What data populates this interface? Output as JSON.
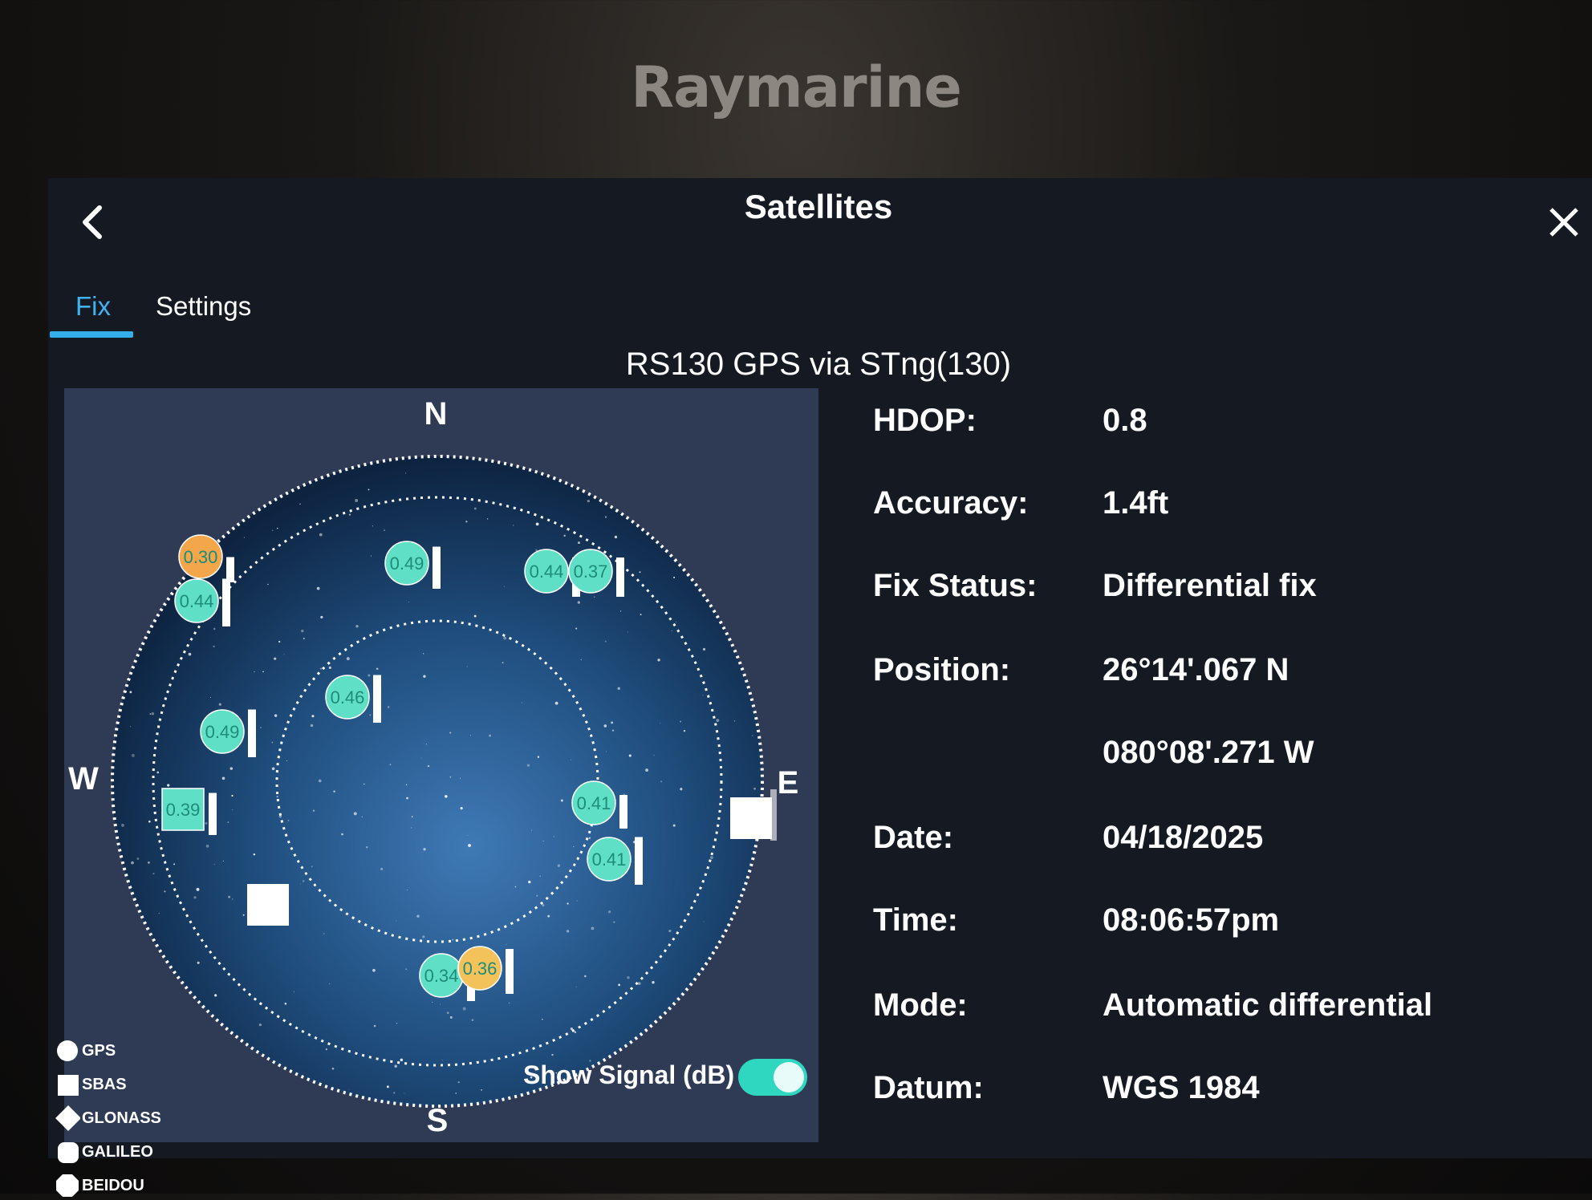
{
  "brand": "Raymarine",
  "header": {
    "title": "Satellites"
  },
  "tabs": [
    {
      "label": "Fix",
      "active": true
    },
    {
      "label": "Settings",
      "active": false
    }
  ],
  "source": "RS130 GPS via STng(130)",
  "compass": {
    "n": "N",
    "s": "S",
    "e": "E",
    "w": "W"
  },
  "satellites": [
    {
      "label": "0.30",
      "type": "GPS",
      "color": "#f3a64a",
      "signal": 0.45
    },
    {
      "label": "0.44",
      "type": "GPS",
      "color": "#5fe0c6",
      "signal": 0.85
    },
    {
      "label": "0.49",
      "type": "GPS",
      "color": "#5fe0c6",
      "signal": 0.75
    },
    {
      "label": "0.44",
      "type": "GPS",
      "color": "#5fe0c6",
      "signal": 0.7
    },
    {
      "label": "0.37",
      "type": "GPS",
      "color": "#5fe0c6",
      "signal": 0.7
    },
    {
      "label": "0.46",
      "type": "GPS",
      "color": "#5fe0c6",
      "signal": 0.85
    },
    {
      "label": "0.49",
      "type": "GPS",
      "color": "#5fe0c6",
      "signal": 0.85
    },
    {
      "label": "0.39",
      "type": "SBAS",
      "color": "#5fe0c6",
      "signal": 0.75
    },
    {
      "label": "0.41",
      "type": "GPS",
      "color": "#5fe0c6",
      "signal": 0.6
    },
    {
      "label": "0.41",
      "type": "GPS",
      "color": "#5fe0c6",
      "signal": 0.85
    },
    {
      "label": "0.34",
      "type": "GPS",
      "color": "#5fe0c6",
      "signal": 0.55
    },
    {
      "label": "0.36",
      "type": "GPS",
      "color": "#f3c25a",
      "signal": 0.8
    }
  ],
  "legend": [
    "GPS",
    "SBAS",
    "GLONASS",
    "GALILEO",
    "BEIDOU"
  ],
  "show_signal": {
    "label": "Show Signal (dB)",
    "on": true
  },
  "info": [
    {
      "label": "HDOP:",
      "value": "0.8"
    },
    {
      "label": "Accuracy:",
      "value": "1.4ft"
    },
    {
      "label": "Fix Status:",
      "value": "Differential fix"
    },
    {
      "label": "Position:",
      "value": "26°14'.067 N"
    },
    {
      "label": "",
      "value": "080°08'.271 W"
    },
    {
      "label": "Date:",
      "value": "04/18/2025"
    },
    {
      "label": "Time:",
      "value": "08:06:57pm"
    },
    {
      "label": "Mode:",
      "value": "Automatic differential"
    },
    {
      "label": "Datum:",
      "value": "WGS 1984"
    }
  ],
  "colors": {
    "accent": "#3fb3f0",
    "satellite": "#5fe0c6",
    "toggle": "#2fd6c0"
  }
}
